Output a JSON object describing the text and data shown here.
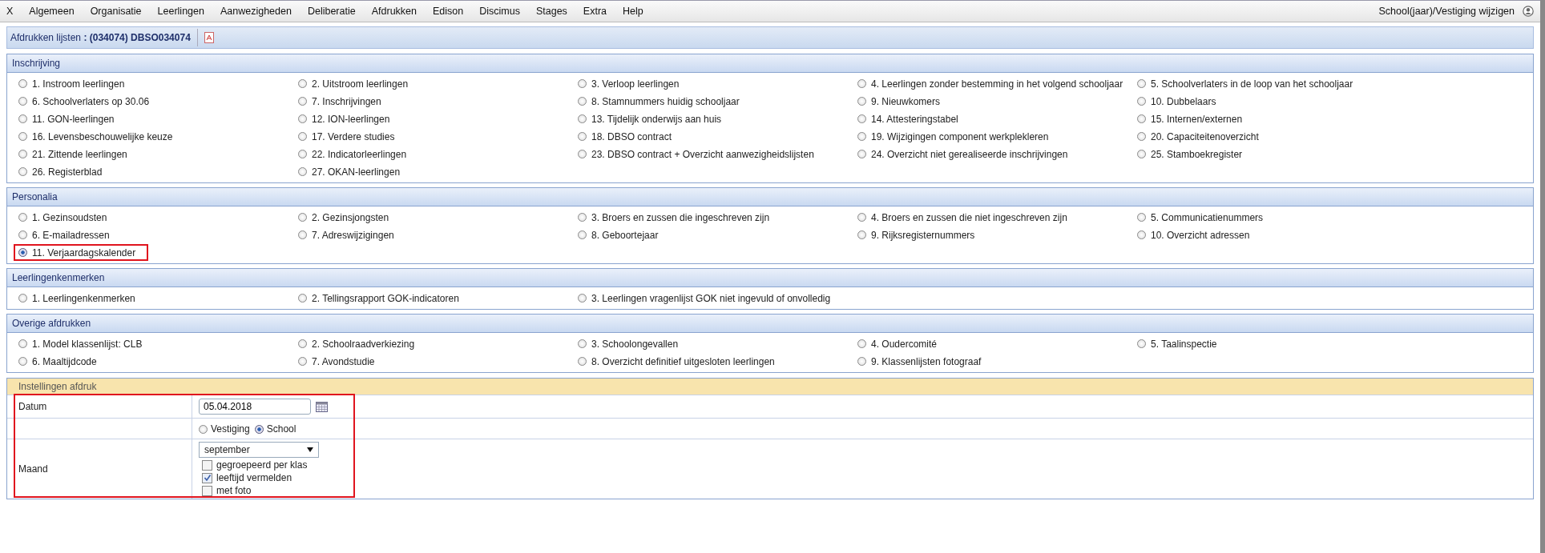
{
  "menu": {
    "close": "X",
    "items": [
      "Algemeen",
      "Organisatie",
      "Leerlingen",
      "Aanwezigheden",
      "Deliberatie",
      "Afdrukken",
      "Edison",
      "Discimus",
      "Stages",
      "Extra",
      "Help"
    ],
    "right_link": "School(jaar)/Vestiging wijzigen"
  },
  "title_bar": {
    "label": "Afdrukken lijsten",
    "value": ": (034074) DBSO034074"
  },
  "sections": [
    {
      "title": "Inschrijving",
      "options": [
        {
          "label": "1. Instroom leerlingen",
          "selected": false,
          "highlighted": false
        },
        {
          "label": "2. Uitstroom leerlingen",
          "selected": false,
          "highlighted": false
        },
        {
          "label": "3. Verloop leerlingen",
          "selected": false,
          "highlighted": false
        },
        {
          "label": "4. Leerlingen zonder bestemming in het volgend schooljaar",
          "selected": false,
          "highlighted": false
        },
        {
          "label": "5. Schoolverlaters in de loop van het schooljaar",
          "selected": false,
          "highlighted": false
        },
        {
          "label": "6. Schoolverlaters op 30.06",
          "selected": false,
          "highlighted": false
        },
        {
          "label": "7. Inschrijvingen",
          "selected": false,
          "highlighted": false
        },
        {
          "label": "8. Stamnummers huidig schooljaar",
          "selected": false,
          "highlighted": false
        },
        {
          "label": "9. Nieuwkomers",
          "selected": false,
          "highlighted": false
        },
        {
          "label": "10. Dubbelaars",
          "selected": false,
          "highlighted": false
        },
        {
          "label": "11. GON-leerlingen",
          "selected": false,
          "highlighted": false
        },
        {
          "label": "12. ION-leerlingen",
          "selected": false,
          "highlighted": false
        },
        {
          "label": "13. Tijdelijk onderwijs aan huis",
          "selected": false,
          "highlighted": false
        },
        {
          "label": "14. Attesteringstabel",
          "selected": false,
          "highlighted": false
        },
        {
          "label": "15. Internen/externen",
          "selected": false,
          "highlighted": false
        },
        {
          "label": "16. Levensbeschouwelijke keuze",
          "selected": false,
          "highlighted": false
        },
        {
          "label": "17. Verdere studies",
          "selected": false,
          "highlighted": false
        },
        {
          "label": "18. DBSO contract",
          "selected": false,
          "highlighted": false
        },
        {
          "label": "19. Wijzigingen component werkplekleren",
          "selected": false,
          "highlighted": false
        },
        {
          "label": "20. Capaciteitenoverzicht",
          "selected": false,
          "highlighted": false
        },
        {
          "label": "21. Zittende leerlingen",
          "selected": false,
          "highlighted": false
        },
        {
          "label": "22. Indicatorleerlingen",
          "selected": false,
          "highlighted": false
        },
        {
          "label": "23. DBSO contract + Overzicht aanwezigheidslijsten",
          "selected": false,
          "highlighted": false
        },
        {
          "label": "24. Overzicht niet gerealiseerde inschrijvingen",
          "selected": false,
          "highlighted": false
        },
        {
          "label": "25. Stamboekregister",
          "selected": false,
          "highlighted": false
        },
        {
          "label": "26. Registerblad",
          "selected": false,
          "highlighted": false
        },
        {
          "label": "27. OKAN-leerlingen",
          "selected": false,
          "highlighted": false
        }
      ]
    },
    {
      "title": "Personalia",
      "options": [
        {
          "label": "1. Gezinsoudsten",
          "selected": false,
          "highlighted": false
        },
        {
          "label": "2. Gezinsjongsten",
          "selected": false,
          "highlighted": false
        },
        {
          "label": "3. Broers en zussen die ingeschreven zijn",
          "selected": false,
          "highlighted": false
        },
        {
          "label": "4. Broers en zussen die niet ingeschreven zijn",
          "selected": false,
          "highlighted": false
        },
        {
          "label": "5. Communicatienummers",
          "selected": false,
          "highlighted": false
        },
        {
          "label": "6. E-mailadressen",
          "selected": false,
          "highlighted": false
        },
        {
          "label": "7. Adreswijzigingen",
          "selected": false,
          "highlighted": false
        },
        {
          "label": "8. Geboortejaar",
          "selected": false,
          "highlighted": false
        },
        {
          "label": "9. Rijksregisternummers",
          "selected": false,
          "highlighted": false
        },
        {
          "label": "10. Overzicht adressen",
          "selected": false,
          "highlighted": false
        },
        {
          "label": "11. Verjaardagskalender",
          "selected": true,
          "highlighted": true
        }
      ]
    },
    {
      "title": "Leerlingenkenmerken",
      "options": [
        {
          "label": "1. Leerlingenkenmerken",
          "selected": false,
          "highlighted": false
        },
        {
          "label": "2. Tellingsrapport GOK-indicatoren",
          "selected": false,
          "highlighted": false
        },
        {
          "label": "3. Leerlingen vragenlijst GOK niet ingevuld of onvolledig",
          "selected": false,
          "highlighted": false
        }
      ]
    },
    {
      "title": "Overige afdrukken",
      "options": [
        {
          "label": "1. Model klassenlijst: CLB",
          "selected": false,
          "highlighted": false
        },
        {
          "label": "2. Schoolraadverkiezing",
          "selected": false,
          "highlighted": false
        },
        {
          "label": "3. Schoolongevallen",
          "selected": false,
          "highlighted": false
        },
        {
          "label": "4. Oudercomité",
          "selected": false,
          "highlighted": false
        },
        {
          "label": "5. Taalinspectie",
          "selected": false,
          "highlighted": false
        },
        {
          "label": "6. Maaltijdcode",
          "selected": false,
          "highlighted": false
        },
        {
          "label": "7. Avondstudie",
          "selected": false,
          "highlighted": false
        },
        {
          "label": "8. Overzicht definitief uitgesloten leerlingen",
          "selected": false,
          "highlighted": false
        },
        {
          "label": "9. Klassenlijsten fotograaf",
          "selected": false,
          "highlighted": false
        }
      ]
    }
  ],
  "settings": {
    "title": "Instellingen afdruk",
    "highlighted": true,
    "date_label": "Datum",
    "date_value": "05.04.2018",
    "scope_options": [
      {
        "label": "Vestiging",
        "selected": false
      },
      {
        "label": "School",
        "selected": true
      }
    ],
    "month_label": "Maand",
    "month_value": "september",
    "checkboxes": [
      {
        "label": "gegroepeerd per klas",
        "checked": false
      },
      {
        "label": "leeftijd vermelden",
        "checked": true
      },
      {
        "label": "met foto",
        "checked": false
      }
    ]
  }
}
